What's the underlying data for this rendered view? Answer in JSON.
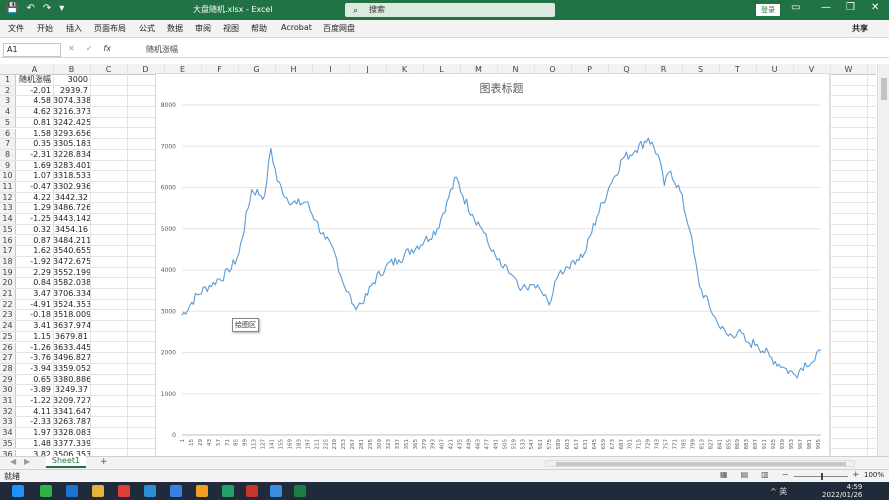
{
  "window": {
    "title": "大盘随机.xlsx  -  Excel",
    "search_placeholder": "搜索",
    "login_label": "登录"
  },
  "ribbon": {
    "tabs": [
      "文件",
      "开始",
      "插入",
      "页面布局",
      "公式",
      "数据",
      "审阅",
      "视图",
      "帮助",
      "Acrobat",
      "百度网盘"
    ],
    "share_label": "共享"
  },
  "formula_bar": {
    "name_box": "A1",
    "cancel_glyph": "✕",
    "enter_glyph": "✓",
    "fx_label": "fx",
    "content": "随机涨幅"
  },
  "grid": {
    "columns": [
      "A",
      "B",
      "C",
      "D",
      "E",
      "F",
      "G",
      "H",
      "I",
      "J",
      "K",
      "L",
      "M",
      "N",
      "O",
      "P",
      "Q",
      "R",
      "S",
      "T",
      "U",
      "V",
      "W"
    ],
    "rows": [
      {
        "n": "1",
        "a": "随机涨幅",
        "b": "3000"
      },
      {
        "n": "2",
        "a": "-2.01",
        "b": "2939.7"
      },
      {
        "n": "3",
        "a": "4.58",
        "b": "3074.338"
      },
      {
        "n": "4",
        "a": "4.62",
        "b": "3216.373"
      },
      {
        "n": "5",
        "a": "0.81",
        "b": "3242.425"
      },
      {
        "n": "6",
        "a": "1.58",
        "b": "3293.656"
      },
      {
        "n": "7",
        "a": "0.35",
        "b": "3305.183"
      },
      {
        "n": "8",
        "a": "-2.31",
        "b": "3228.834"
      },
      {
        "n": "9",
        "a": "1.69",
        "b": "3283.401"
      },
      {
        "n": "10",
        "a": "1.07",
        "b": "3318.533"
      },
      {
        "n": "11",
        "a": "-0.47",
        "b": "3302.936"
      },
      {
        "n": "12",
        "a": "4.22",
        "b": "3442.32"
      },
      {
        "n": "13",
        "a": "1.29",
        "b": "3486.726"
      },
      {
        "n": "14",
        "a": "-1.25",
        "b": "3443.142"
      },
      {
        "n": "15",
        "a": "0.32",
        "b": "3454.16"
      },
      {
        "n": "16",
        "a": "0.87",
        "b": "3484.211"
      },
      {
        "n": "17",
        "a": "1.62",
        "b": "3540.655"
      },
      {
        "n": "18",
        "a": "-1.92",
        "b": "3472.675"
      },
      {
        "n": "19",
        "a": "2.29",
        "b": "3552.199"
      },
      {
        "n": "20",
        "a": "0.84",
        "b": "3582.038"
      },
      {
        "n": "21",
        "a": "3.47",
        "b": "3706.334"
      },
      {
        "n": "22",
        "a": "-4.91",
        "b": "3524.353"
      },
      {
        "n": "23",
        "a": "-0.18",
        "b": "3518.009"
      },
      {
        "n": "24",
        "a": "3.41",
        "b": "3637.974"
      },
      {
        "n": "25",
        "a": "1.15",
        "b": "3679.81"
      },
      {
        "n": "26",
        "a": "-1.26",
        "b": "3633.445"
      },
      {
        "n": "27",
        "a": "-3.76",
        "b": "3496.827"
      },
      {
        "n": "28",
        "a": "-3.94",
        "b": "3359.052"
      },
      {
        "n": "29",
        "a": "0.65",
        "b": "3380.886"
      },
      {
        "n": "30",
        "a": "-3.89",
        "b": "3249.37"
      },
      {
        "n": "31",
        "a": "-1.22",
        "b": "3209.727"
      },
      {
        "n": "32",
        "a": "4.11",
        "b": "3341.647"
      },
      {
        "n": "33",
        "a": "-2.33",
        "b": "3263.787"
      },
      {
        "n": "34",
        "a": "1.97",
        "b": "3328.083"
      },
      {
        "n": "35",
        "a": "1.48",
        "b": "3377.339"
      },
      {
        "n": "36",
        "a": "3.82",
        "b": "3506.353"
      }
    ]
  },
  "chart_data": {
    "type": "line",
    "title": "图表标题",
    "xlabel": "",
    "ylabel": "",
    "ylim": [
      0,
      8000
    ],
    "yticks": [
      0,
      1000,
      2000,
      3000,
      4000,
      5000,
      6000,
      7000,
      8000
    ],
    "xlim": [
      1,
      1000
    ],
    "x_tick_start": 1,
    "x_tick_step": 14,
    "grid": true,
    "line_color": "#5b9bd5",
    "series": [
      {
        "x": [
          1,
          25,
          50,
          75,
          90,
          110,
          130,
          140,
          150,
          165,
          180,
          195,
          210,
          225,
          240,
          255,
          270,
          285,
          300,
          320,
          340,
          360,
          380,
          400,
          415,
          430,
          440,
          455,
          470,
          485,
          500,
          515,
          530,
          545,
          560,
          575,
          590,
          610,
          630,
          650,
          670,
          690,
          710,
          730,
          745,
          755,
          765,
          780,
          795,
          810,
          825,
          840,
          855,
          870,
          885,
          900,
          920,
          940,
          960,
          975,
          990,
          1000
        ],
        "values": [
          2900,
          3400,
          3700,
          3950,
          4400,
          5950,
          5800,
          6950,
          6150,
          5750,
          5600,
          5650,
          5200,
          4750,
          4400,
          3600,
          3150,
          3200,
          3700,
          4100,
          4250,
          4500,
          4700,
          5000,
          5650,
          6250,
          5800,
          5350,
          5000,
          4450,
          4100,
          3900,
          3500,
          3650,
          3550,
          3150,
          3900,
          4200,
          4400,
          5300,
          6050,
          6700,
          6900,
          7200,
          6800,
          6050,
          6400,
          5900,
          4950,
          3600,
          3150,
          2650,
          2400,
          2500,
          2250,
          2200,
          1900,
          1650,
          1450,
          1750,
          1800,
          2050
        ]
      }
    ]
  },
  "chart_tooltip": "绘图区",
  "sheet": {
    "tab_label": "Sheet1",
    "add_label": "+",
    "prev_glyph": "◀",
    "next_glyph": "▶"
  },
  "status": {
    "ready": "就绪",
    "zoom": "100%",
    "zoom_minus": "−",
    "zoom_plus": "+"
  },
  "taskbar": {
    "tray_text": "^ 英",
    "time": "4:59",
    "date": "2022/01/26"
  }
}
